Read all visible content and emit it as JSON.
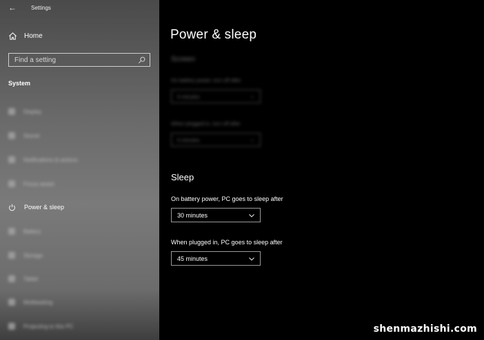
{
  "window": {
    "title": "Settings",
    "watermark": "shenmazhishi.com"
  },
  "sidebar": {
    "home_label": "Home",
    "search_placeholder": "Find a setting",
    "section_label": "System",
    "items": [
      {
        "label": "Display",
        "icon": "display-icon",
        "blurred": true
      },
      {
        "label": "Sound",
        "icon": "sound-icon",
        "blurred": true
      },
      {
        "label": "Notifications & actions",
        "icon": "notifications-icon",
        "blurred": true
      },
      {
        "label": "Focus assist",
        "icon": "focus-assist-icon",
        "blurred": true
      },
      {
        "label": "Power & sleep",
        "icon": "power-icon",
        "blurred": false
      },
      {
        "label": "Battery",
        "icon": "battery-icon",
        "blurred": true
      },
      {
        "label": "Storage",
        "icon": "storage-icon",
        "blurred": true
      },
      {
        "label": "Tablet",
        "icon": "tablet-icon",
        "blurred": true
      },
      {
        "label": "Multitasking",
        "icon": "multitasking-icon",
        "blurred": true
      },
      {
        "label": "Projecting to this PC",
        "icon": "projecting-icon",
        "blurred": true
      }
    ]
  },
  "main": {
    "page_title": "Power & sleep",
    "screen": {
      "header": "Screen",
      "battery_label": "On battery power, turn off after",
      "battery_value": "5 minutes",
      "plugged_label": "When plugged in, turn off after",
      "plugged_value": "5 minutes"
    },
    "sleep": {
      "header": "Sleep",
      "battery_label": "On battery power, PC goes to sleep after",
      "battery_value": "30 minutes",
      "plugged_label": "When plugged in, PC goes to sleep after",
      "plugged_value": "45 minutes"
    }
  },
  "colors": {
    "background": "#000000",
    "text": "#ffffff",
    "dropdown_border": "#9a9a9a"
  }
}
